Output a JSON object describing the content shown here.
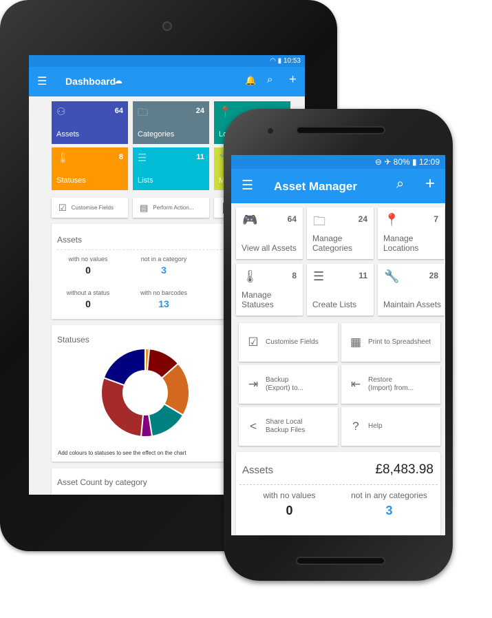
{
  "tablet": {
    "status": {
      "time": "10:53",
      "icons": [
        "wifi-icon",
        "battery-icon"
      ]
    },
    "toolbar": {
      "title": "Dashboard",
      "icons": [
        "menu-icon",
        "cloud-icon",
        "bell-icon",
        "search-icon",
        "plus-icon"
      ]
    },
    "tiles": [
      {
        "label": "Assets",
        "count": "64",
        "color": "#3f51b5",
        "icon": "gamepad-icon"
      },
      {
        "label": "Categories",
        "count": "24",
        "color": "#607d8b",
        "icon": "folder-icon"
      },
      {
        "label": "Loc",
        "count": "",
        "color": "#009688",
        "icon": "location-icon"
      },
      {
        "label": "Statuses",
        "count": "8",
        "color": "#ff9800",
        "icon": "thermometer-icon"
      },
      {
        "label": "Lists",
        "count": "11",
        "color": "#00bcd4",
        "icon": "list-icon"
      },
      {
        "label": "Ma",
        "count": "",
        "color": "#cddc39",
        "icon": "wrench-icon"
      }
    ],
    "actions": [
      {
        "label": "Customise Fields",
        "icon": "checkbox-icon"
      },
      {
        "label": "Perform Action...",
        "icon": "calendar-icon"
      },
      {
        "label": "",
        "icon": "barcode-icon"
      }
    ],
    "assets": {
      "title": "Assets",
      "stats": [
        {
          "label": "with no values",
          "value": "0"
        },
        {
          "label": "not in a category",
          "value": "3"
        },
        {
          "label": "no",
          "value": ""
        },
        {
          "label": "without a status",
          "value": "0"
        },
        {
          "label": "with no barcodes",
          "value": "13"
        },
        {
          "label": "w",
          "value": ""
        }
      ]
    },
    "statuses": {
      "title": "Statuses",
      "note": "Add colours to statuses to see the effect on the chart"
    },
    "asset_count": {
      "title": "Asset Count by category"
    }
  },
  "chart_data": {
    "type": "pie",
    "donut": true,
    "values": [
      1.5,
      12,
      20,
      14,
      4,
      29,
      19.5
    ],
    "colors": [
      "#f28c28",
      "#800000",
      "#d2691e",
      "#008080",
      "#800080",
      "#a52a2a",
      "#000080"
    ]
  },
  "phone": {
    "status": {
      "battery": "80%",
      "time": "12:09",
      "icons": [
        "do-not-disturb-icon",
        "airplane-icon",
        "battery-icon"
      ]
    },
    "toolbar": {
      "title": "Asset Manager"
    },
    "tiles": [
      {
        "label": "View\nall Assets",
        "count": "64",
        "icon": "gamepad-icon",
        "glyph": "🎮"
      },
      {
        "label": "Manage Categories",
        "count": "24",
        "icon": "folder-icon",
        "glyph": "🗀"
      },
      {
        "label": "Manage Locations",
        "count": "7",
        "icon": "location-icon",
        "glyph": "📍"
      },
      {
        "label": "Manage Statuses",
        "count": "8",
        "icon": "thermometer-icon",
        "glyph": "🌡"
      },
      {
        "label": "Create Lists",
        "count": "11",
        "icon": "list-icon",
        "glyph": "☰"
      },
      {
        "label": "Maintain Assets",
        "count": "28",
        "icon": "wrench-icon",
        "glyph": "🔧"
      }
    ],
    "actions": [
      {
        "label": "Customise Fields",
        "icon": "checkbox-icon",
        "glyph": "☑"
      },
      {
        "label": "Print to Spreadsheet",
        "icon": "excel-icon",
        "glyph": "▦"
      },
      {
        "label": "Backup\n(Export) to...",
        "icon": "export-icon",
        "glyph": "⇥"
      },
      {
        "label": "Restore\n(Import) from...",
        "icon": "import-icon",
        "glyph": "⇤"
      },
      {
        "label": "Share Local\nBackup Files",
        "icon": "share-icon",
        "glyph": "<"
      },
      {
        "label": "Help",
        "icon": "help-icon",
        "glyph": "?"
      }
    ],
    "assets": {
      "title": "Assets",
      "total": "£8,483.98",
      "stats": [
        {
          "label": "with no values",
          "value": "0"
        },
        {
          "label": "not in any categories",
          "value": "3"
        }
      ]
    }
  }
}
